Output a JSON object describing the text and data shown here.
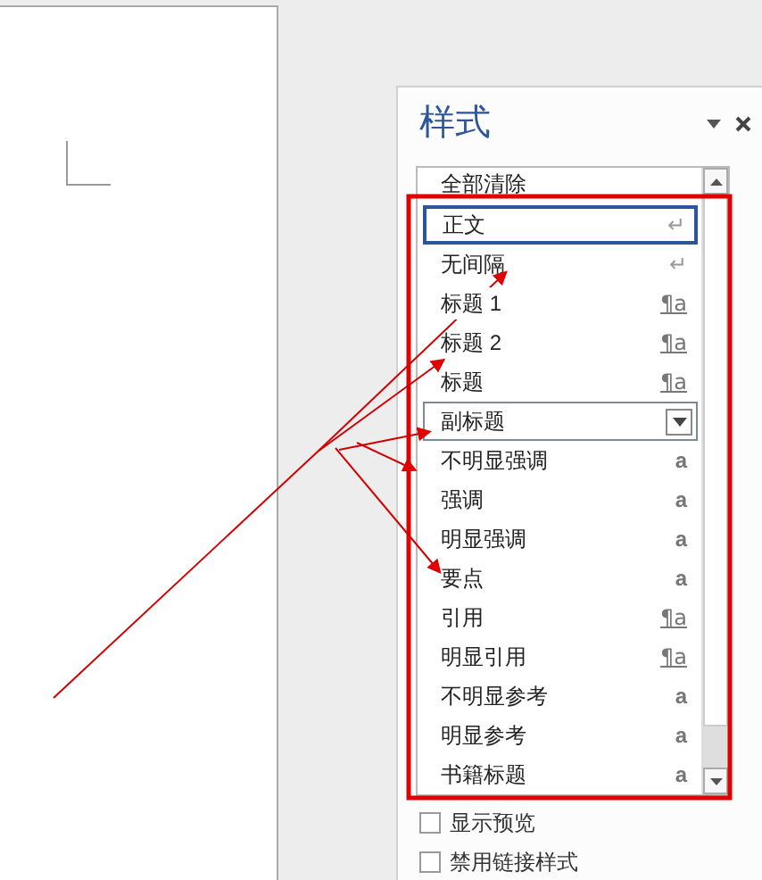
{
  "pane": {
    "title": "样式"
  },
  "styles": [
    {
      "name": "全部清除",
      "selected": false,
      "hovered": false
    },
    {
      "name": "正文",
      "symbol": "↵",
      "kind": "paragraph",
      "selected": true,
      "hovered": false
    },
    {
      "name": "无间隔",
      "symbol": "↵",
      "kind": "paragraph",
      "selected": false,
      "hovered": false
    },
    {
      "name": "标题 1",
      "symbol": "¶a",
      "kind": "linked",
      "selected": false,
      "hovered": false
    },
    {
      "name": "标题 2",
      "symbol": "¶a",
      "kind": "linked",
      "selected": false,
      "hovered": false
    },
    {
      "name": "标题",
      "symbol": "¶a",
      "kind": "linked",
      "selected": false,
      "hovered": false
    },
    {
      "name": "副标题",
      "selected": false,
      "hovered": true
    },
    {
      "name": "不明显强调",
      "symbol": "a",
      "kind": "character",
      "selected": false,
      "hovered": false
    },
    {
      "name": "强调",
      "symbol": "a",
      "kind": "character",
      "selected": false,
      "hovered": false
    },
    {
      "name": "明显强调",
      "symbol": "a",
      "kind": "character",
      "selected": false,
      "hovered": false
    },
    {
      "name": "要点",
      "symbol": "a",
      "kind": "character",
      "selected": false,
      "hovered": false
    },
    {
      "name": "引用",
      "symbol": "¶a",
      "kind": "linked",
      "selected": false,
      "hovered": false
    },
    {
      "name": "明显引用",
      "symbol": "¶a",
      "kind": "linked",
      "selected": false,
      "hovered": false
    },
    {
      "name": "不明显参考",
      "symbol": "a",
      "kind": "character",
      "selected": false,
      "hovered": false
    },
    {
      "name": "明显参考",
      "symbol": "a",
      "kind": "character",
      "selected": false,
      "hovered": false
    },
    {
      "name": "书籍标题",
      "symbol": "a",
      "kind": "character",
      "selected": false,
      "hovered": false
    }
  ],
  "options": [
    {
      "label": "显示预览",
      "checked": false
    },
    {
      "label": "禁用链接样式",
      "checked": false
    }
  ]
}
